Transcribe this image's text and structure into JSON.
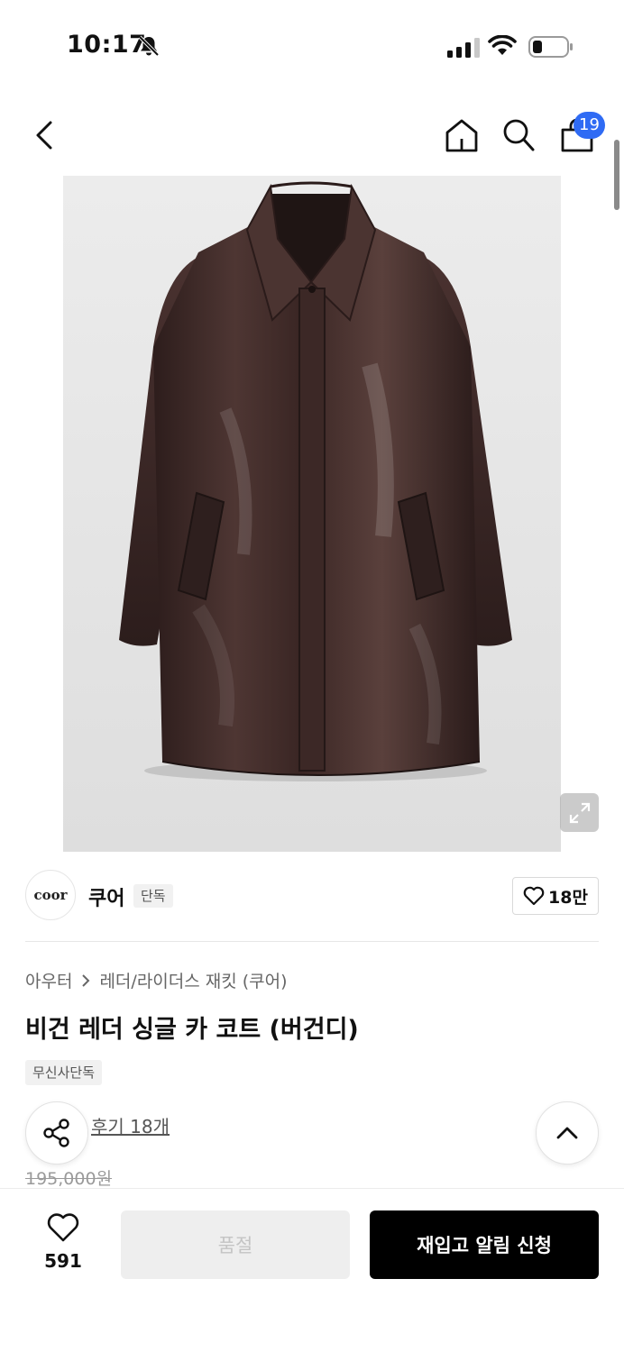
{
  "status_bar": {
    "time": "10:17"
  },
  "nav": {
    "cart_count": "19"
  },
  "brand": {
    "logo_text": "coor",
    "name": "쿠어",
    "tag": "단독",
    "likes": "18만"
  },
  "breadcrumb": {
    "level1": "아우터",
    "level2": "레더/라이더스 재킷 (쿠어)"
  },
  "product": {
    "title": "비건 레더 싱글 카 코트 (버건디)",
    "exclusive_tag": "무신사단독",
    "reviews": "후기 18개",
    "original_price": "195,000원"
  },
  "bottom_bar": {
    "wish_count": "591",
    "soldout_label": "품절",
    "restock_label": "재입고 알림 신청"
  },
  "icons": [
    "mute-icon",
    "signal-icon",
    "wifi-icon",
    "battery-icon",
    "back-icon",
    "home-icon",
    "search-icon",
    "cart-icon",
    "expand-icon",
    "heart-icon",
    "share-icon",
    "chevron-up-icon",
    "chevron-right-icon"
  ],
  "colors": {
    "badge": "#2f6bf4",
    "primary_button": "#000000",
    "disabled_button": "#eeeeee",
    "coat": "#3e2a27"
  }
}
